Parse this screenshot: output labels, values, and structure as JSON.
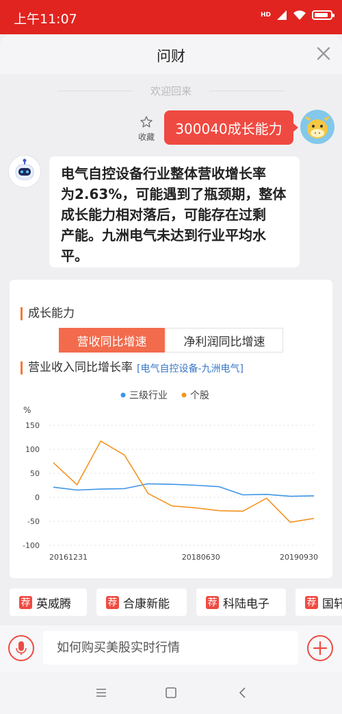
{
  "status_bar": {
    "time": "上午11:07",
    "network": "HD",
    "battery_level": 0.78
  },
  "header": {
    "title": "问财"
  },
  "chat": {
    "welcome": "欢迎回来",
    "favorite_label": "收藏",
    "user_message": "300040成长能力",
    "bot_message_lines": [
      "电气自控设备行业整体营收增长率",
      "为2.63%，可能遇到了瓶颈期，整体",
      "成长能力相对落后，可能存在过剩",
      "产能。九洲电气未达到行业平均水",
      "平。"
    ]
  },
  "card": {
    "section_title": "成长能力",
    "tabs": [
      {
        "label": "营收同比增速",
        "active": true
      },
      {
        "label": "净利润同比增速",
        "active": false
      }
    ],
    "chart_title": "营业收入同比增长率",
    "chart_subtitle": "[电气自控设备-九洲电气]"
  },
  "chart_data": {
    "type": "line",
    "legend_position": "top-center",
    "y_unit": "%",
    "ylim": [
      -100,
      150
    ],
    "yticks": [
      150,
      100,
      50,
      0,
      -50,
      -100
    ],
    "x_tick_labels": [
      "20161231",
      "20180630",
      "20190930"
    ],
    "x": [
      "20161231",
      "20170331",
      "20170630",
      "20170930",
      "20171231",
      "20180331",
      "20180630",
      "20180930",
      "20181231",
      "20190331",
      "20190630",
      "20190930"
    ],
    "grid": true,
    "series": [
      {
        "name": "三级行业",
        "color": "#3d95e6",
        "values": [
          21,
          15,
          17,
          18,
          28,
          27,
          25,
          22,
          5,
          6,
          2,
          3
        ]
      },
      {
        "name": "个股",
        "color": "#f2941f",
        "values": [
          72,
          26,
          117,
          88,
          8,
          -18,
          -22,
          -28,
          -29,
          -2,
          -52,
          -44
        ]
      }
    ]
  },
  "suggestions": [
    {
      "tag": "荐",
      "label": "英威腾"
    },
    {
      "tag": "荐",
      "label": "合康新能"
    },
    {
      "tag": "荐",
      "label": "科陆电子"
    },
    {
      "tag": "荐",
      "label": "国轩"
    }
  ],
  "input": {
    "placeholder": "如何购买美股实时行情"
  },
  "colors": {
    "brand_red": "#e1241f",
    "accent_orange": "#f26b4c",
    "link_blue": "#3577c8"
  },
  "icons": [
    "signal-icon",
    "wifi-icon",
    "battery-icon",
    "close-icon",
    "star-icon",
    "user-avatar-icon",
    "bot-avatar-icon",
    "mic-icon",
    "plus-icon",
    "menu-icon",
    "home-icon",
    "back-icon"
  ]
}
